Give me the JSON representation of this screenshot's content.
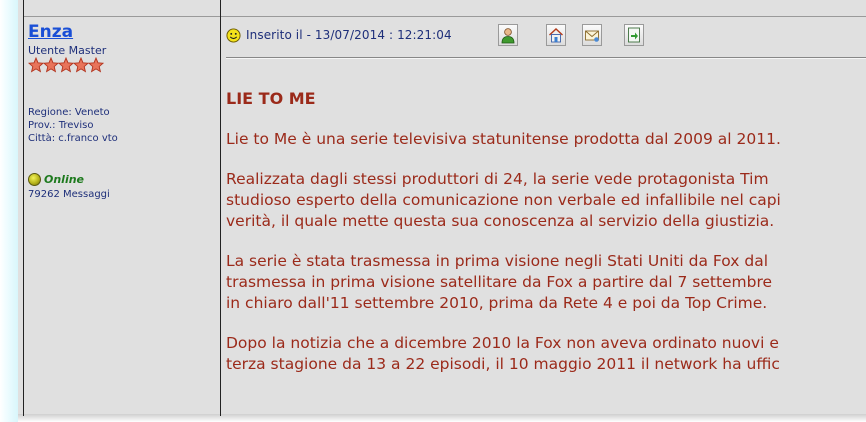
{
  "author": {
    "name": "Enza",
    "rank": "Utente Master",
    "stars": 5,
    "info": [
      "Regione: Veneto",
      "Prov.: Treviso",
      "Città: c.franco vto"
    ],
    "status": "Online",
    "messages": "79262 Messaggi"
  },
  "post": {
    "inserted": "Inserito il  -  13/07/2014 :  12:21:04",
    "icons": [
      "profile-icon",
      "home-icon",
      "email-icon",
      "reply-quote-icon"
    ],
    "title": "LIE TO ME",
    "paragraphs": [
      [
        "Lie to Me è una serie televisiva statunitense prodotta dal 2009 al 2011."
      ],
      [
        "Realizzata dagli stessi produttori di 24, la serie vede protagonista Tim",
        "studioso esperto della comunicazione non verbale ed infallibile nel capi",
        "verità, il quale mette questa sua conoscenza al servizio della giustizia."
      ],
      [
        "La serie è stata trasmessa in prima visione negli Stati Uniti da Fox dal",
        "trasmessa in prima visione satellitare da Fox a partire dal 7 settembre",
        "in chiaro dall'11 settembre 2010, prima da Rete 4 e poi da Top Crime."
      ],
      [
        "Dopo la notizia che a dicembre 2010 la Fox non aveva ordinato nuovi e",
        "terza stagione da 13 a 22 episodi, il 10 maggio 2011 il network ha uffic"
      ]
    ]
  },
  "colors": {
    "background": "#e0e0e0",
    "author_link": "#1a4fd6",
    "meta_text": "#1e2f7a",
    "post_text": "#9b2a1a",
    "online": "#1e7a1e"
  }
}
